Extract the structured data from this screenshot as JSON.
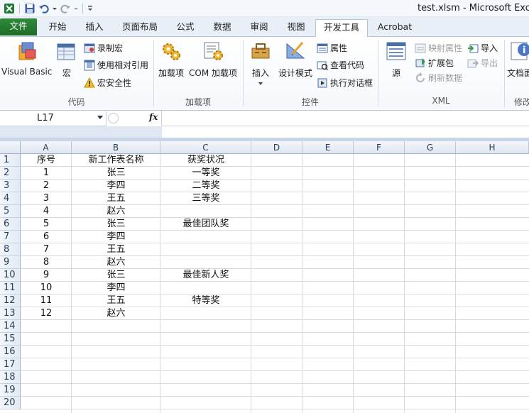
{
  "window": {
    "title": "test.xlsm  -  Microsoft Excel"
  },
  "ribbon_tabs": [
    {
      "label": "文件",
      "state": "file"
    },
    {
      "label": "开始",
      "state": ""
    },
    {
      "label": "插入",
      "state": ""
    },
    {
      "label": "页面布局",
      "state": ""
    },
    {
      "label": "公式",
      "state": ""
    },
    {
      "label": "数据",
      "state": ""
    },
    {
      "label": "审阅",
      "state": ""
    },
    {
      "label": "视图",
      "state": ""
    },
    {
      "label": "开发工具",
      "state": "active"
    },
    {
      "label": "Acrobat",
      "state": ""
    }
  ],
  "ribbon": {
    "code_group": {
      "label": "代码",
      "visual_basic": "Visual Basic",
      "macros": "宏",
      "record_macro": "录制宏",
      "use_relative_refs": "使用相对引用",
      "macro_security": "宏安全性"
    },
    "addins_group": {
      "label": "加载项",
      "addins": "加载项",
      "com_addins": "COM 加载项"
    },
    "controls_group": {
      "label": "控件",
      "insert": "插入",
      "design_mode": "设计模式",
      "properties": "属性",
      "view_code": "查看代码",
      "run_dialog": "执行对话框"
    },
    "xml_group": {
      "label": "XML",
      "source": "源",
      "map_properties": "映射属性",
      "expansion_packs": "扩展包",
      "refresh_data": "刷新数据",
      "import": "导入",
      "export": "导出"
    },
    "modify_group": {
      "label": "修改",
      "document_panel": "文档面"
    }
  },
  "formula_bar": {
    "name_box": "L17",
    "fx_label": "fx",
    "formula": ""
  },
  "sheet": {
    "columns": [
      "A",
      "B",
      "C",
      "D",
      "E",
      "F",
      "G",
      "H"
    ],
    "rows": [
      "1",
      "2",
      "3",
      "4",
      "5",
      "6",
      "7",
      "8",
      "9",
      "10",
      "11",
      "12",
      "13",
      "14",
      "15",
      "16",
      "17",
      "18",
      "19",
      "20"
    ],
    "cells": [
      [
        "序号",
        "新工作表名称",
        "获奖状况"
      ],
      [
        "1",
        "张三",
        "一等奖"
      ],
      [
        "2",
        "李四",
        "二等奖"
      ],
      [
        "3",
        "王五",
        "三等奖"
      ],
      [
        "4",
        "赵六",
        ""
      ],
      [
        "5",
        "张三",
        "最佳团队奖"
      ],
      [
        "6",
        "李四",
        ""
      ],
      [
        "7",
        "王五",
        ""
      ],
      [
        "8",
        "赵六",
        ""
      ],
      [
        "9",
        "张三",
        "最佳新人奖"
      ],
      [
        "10",
        "李四",
        ""
      ],
      [
        "11",
        "王五",
        "特等奖"
      ],
      [
        "12",
        "赵六",
        ""
      ]
    ]
  },
  "colors": {
    "file_tab": "#1d6b27",
    "header_bg": "#dfe7f2",
    "grid_line": "#d4dbe5"
  }
}
